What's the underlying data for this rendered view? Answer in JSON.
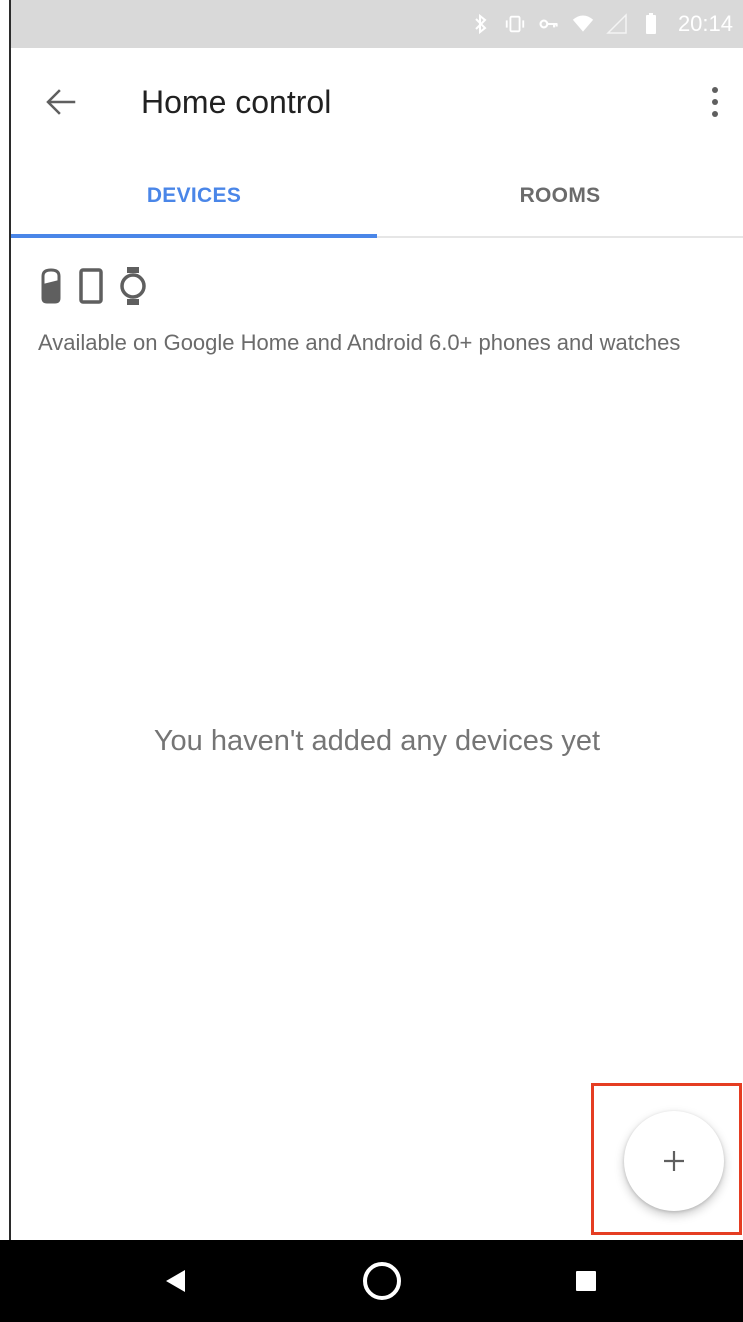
{
  "status_bar": {
    "time": "20:14",
    "icons": [
      "bluetooth-icon",
      "vibrate-icon",
      "vpn-key-icon",
      "wifi-icon",
      "signal-icon",
      "battery-icon"
    ]
  },
  "toolbar": {
    "title": "Home control",
    "back_icon": "arrow-back-icon",
    "overflow_icon": "more-vert-icon"
  },
  "tabs": [
    {
      "label": "DEVICES",
      "active": true
    },
    {
      "label": "ROOMS",
      "active": false
    }
  ],
  "content": {
    "device_icons": [
      "google-home-icon",
      "phone-icon",
      "watch-icon"
    ],
    "availability_text": "Available on Google Home and Android 6.0+ phones and watches",
    "empty_message": "You haven't added any devices yet"
  },
  "fab": {
    "icon": "add-icon",
    "highlight_color": "#e53d22"
  },
  "nav_bar": {
    "icons": [
      "back-triangle-icon",
      "home-circle-icon",
      "recents-square-icon"
    ]
  },
  "colors": {
    "accent": "#4a86e8",
    "status_bar_bg": "#d9d9d9",
    "nav_bar_bg": "#000000"
  }
}
